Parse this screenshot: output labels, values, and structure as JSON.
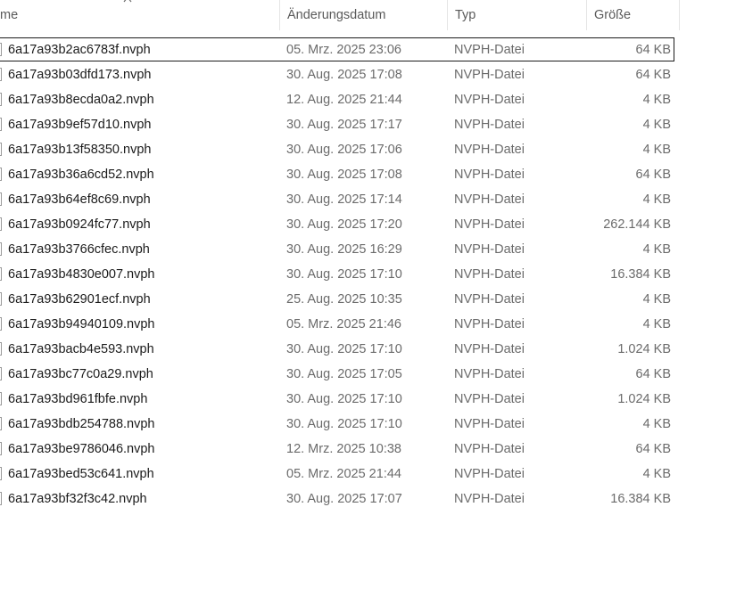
{
  "header": {
    "col_name": "me",
    "col_date": "Änderungsdatum",
    "col_type": "Typ",
    "col_size": "Größe"
  },
  "icons": {
    "sort": "chevron-up-icon",
    "file": "file-icon"
  },
  "files": [
    {
      "name": "6a17a93b2ac6783f.nvph",
      "date": "05. Mrz. 2025 23:06",
      "type": "NVPH-Datei",
      "size": "64 KB",
      "selected": true
    },
    {
      "name": "6a17a93b03dfd173.nvph",
      "date": "30. Aug. 2025 17:08",
      "type": "NVPH-Datei",
      "size": "64 KB"
    },
    {
      "name": "6a17a93b8ecda0a2.nvph",
      "date": "12. Aug. 2025 21:44",
      "type": "NVPH-Datei",
      "size": "4 KB"
    },
    {
      "name": "6a17a93b9ef57d10.nvph",
      "date": "30. Aug. 2025 17:17",
      "type": "NVPH-Datei",
      "size": "4 KB"
    },
    {
      "name": "6a17a93b13f58350.nvph",
      "date": "30. Aug. 2025 17:06",
      "type": "NVPH-Datei",
      "size": "4 KB"
    },
    {
      "name": "6a17a93b36a6cd52.nvph",
      "date": "30. Aug. 2025 17:08",
      "type": "NVPH-Datei",
      "size": "64 KB"
    },
    {
      "name": "6a17a93b64ef8c69.nvph",
      "date": "30. Aug. 2025 17:14",
      "type": "NVPH-Datei",
      "size": "4 KB"
    },
    {
      "name": "6a17a93b0924fc77.nvph",
      "date": "30. Aug. 2025 17:20",
      "type": "NVPH-Datei",
      "size": "262.144 KB"
    },
    {
      "name": "6a17a93b3766cfec.nvph",
      "date": "30. Aug. 2025 16:29",
      "type": "NVPH-Datei",
      "size": "4 KB"
    },
    {
      "name": "6a17a93b4830e007.nvph",
      "date": "30. Aug. 2025 17:10",
      "type": "NVPH-Datei",
      "size": "16.384 KB"
    },
    {
      "name": "6a17a93b62901ecf.nvph",
      "date": "25. Aug. 2025 10:35",
      "type": "NVPH-Datei",
      "size": "4 KB"
    },
    {
      "name": "6a17a93b94940109.nvph",
      "date": "05. Mrz. 2025 21:46",
      "type": "NVPH-Datei",
      "size": "4 KB"
    },
    {
      "name": "6a17a93bacb4e593.nvph",
      "date": "30. Aug. 2025 17:10",
      "type": "NVPH-Datei",
      "size": "1.024 KB"
    },
    {
      "name": "6a17a93bc77c0a29.nvph",
      "date": "30. Aug. 2025 17:05",
      "type": "NVPH-Datei",
      "size": "64 KB"
    },
    {
      "name": "6a17a93bd961fbfe.nvph",
      "date": "30. Aug. 2025 17:10",
      "type": "NVPH-Datei",
      "size": "1.024 KB"
    },
    {
      "name": "6a17a93bdb254788.nvph",
      "date": "30. Aug. 2025 17:10",
      "type": "NVPH-Datei",
      "size": "4 KB"
    },
    {
      "name": "6a17a93be9786046.nvph",
      "date": "12. Mrz. 2025 10:38",
      "type": "NVPH-Datei",
      "size": "64 KB"
    },
    {
      "name": "6a17a93bed53c641.nvph",
      "date": "05. Mrz. 2025 21:44",
      "type": "NVPH-Datei",
      "size": "4 KB"
    },
    {
      "name": "6a17a93bf32f3c42.nvph",
      "date": "30. Aug. 2025 17:07",
      "type": "NVPH-Datei",
      "size": "16.384 KB"
    }
  ]
}
